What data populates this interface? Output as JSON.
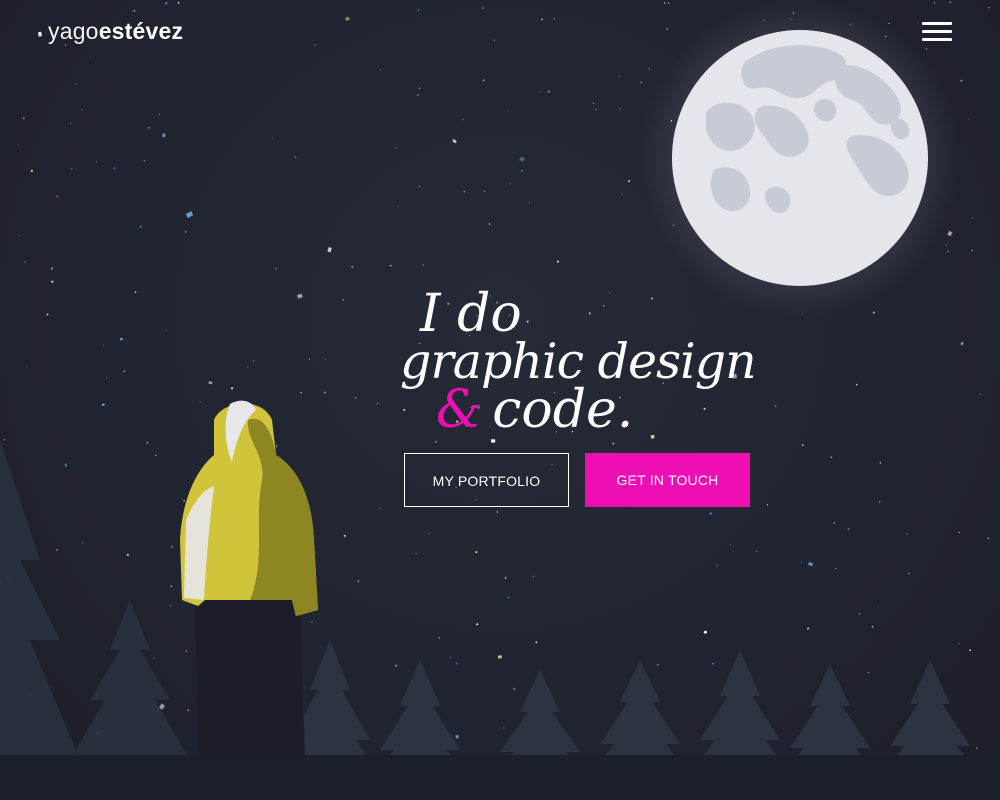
{
  "header": {
    "logo_first": "yago",
    "logo_last": "estévez",
    "menu_icon": "hamburger-menu-icon"
  },
  "hero": {
    "line1": "I do",
    "line2": "graphic design",
    "amp": "&",
    "line3": "code."
  },
  "buttons": {
    "portfolio_label": "MY PORTFOLIO",
    "contact_label": "GET IN TOUCH"
  },
  "colors": {
    "background": "#202430",
    "accent": "#ee0fb4",
    "moon": "#e3e6eb",
    "moon_craters": "#c7ccd4",
    "jacket": "#cfc43a",
    "trees": "#2c3240"
  }
}
